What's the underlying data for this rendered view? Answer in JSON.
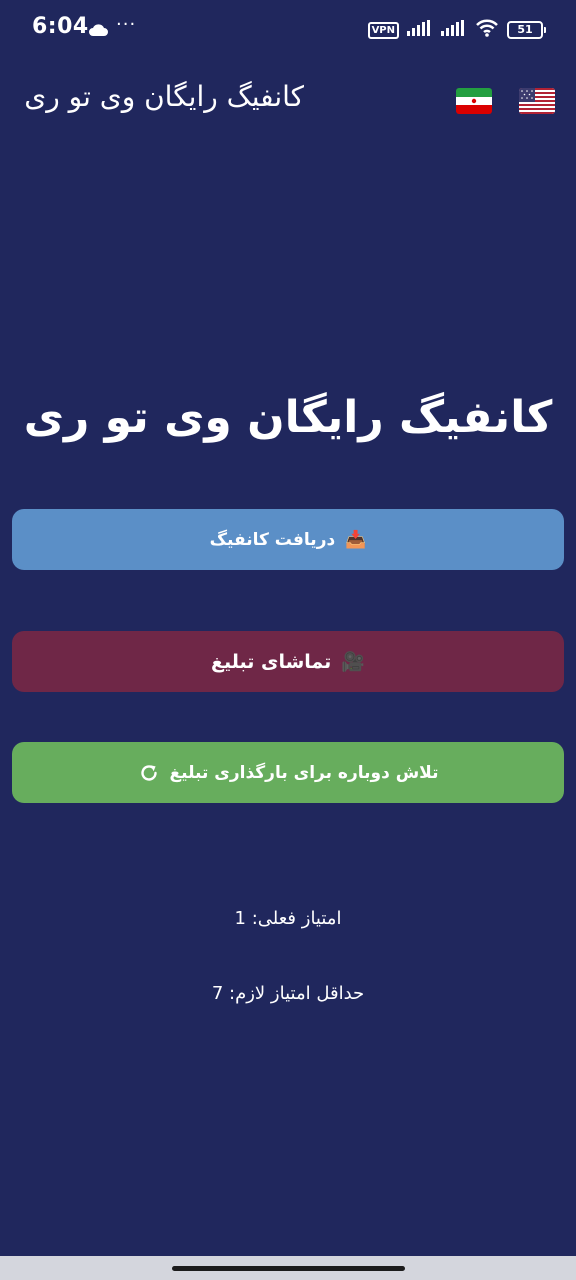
{
  "status_bar": {
    "time": "6:04",
    "more": "···",
    "vpn": "VPN",
    "battery": "51"
  },
  "app_bar": {
    "title": "کانفیگ رایگان وی تو ری",
    "flags": [
      "iran-flag",
      "usa-flag"
    ]
  },
  "main": {
    "heading": "کانفیگ رایگان وی تو ری",
    "buttons": {
      "get_config": {
        "label": "دریافت کانفیگ",
        "icon": "📥",
        "color": "#5b8fc7"
      },
      "watch_ad": {
        "label": "تماشای تبلیغ",
        "icon": "🎥",
        "color": "#6f2747"
      },
      "retry_ad": {
        "label": "تلاش دوباره برای بارگذاری تبلیغ",
        "icon": "refresh-icon",
        "color": "#67ad5d"
      }
    },
    "current_score": "امتیاز فعلی: 1",
    "min_score": "حداقل امتیاز لازم: 7"
  },
  "colors": {
    "background": "#20275d"
  }
}
